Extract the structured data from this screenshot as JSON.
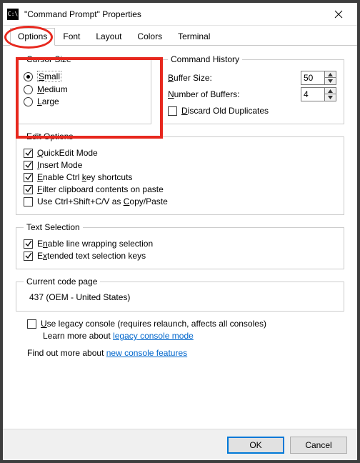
{
  "window": {
    "title": "\"Command Prompt\" Properties"
  },
  "tabs": {
    "options": "Options",
    "font": "Font",
    "layout": "Layout",
    "colors": "Colors",
    "terminal": "Terminal"
  },
  "cursor_size": {
    "legend": "Cursor Size",
    "small": "Small",
    "medium": "Medium",
    "large": "Large"
  },
  "command_history": {
    "legend": "Command History",
    "buffer_size_label": "Buffer Size:",
    "buffer_size_value": "50",
    "num_buffers_label": "Number of Buffers:",
    "num_buffers_value": "4",
    "discard_label": "Discard Old Duplicates"
  },
  "edit_options": {
    "legend": "Edit Options",
    "quickedit": "QuickEdit Mode",
    "insert": "Insert Mode",
    "ctrl_shortcuts": "Enable Ctrl key shortcuts",
    "filter_clip": "Filter clipboard contents on paste",
    "use_cs_cv": "Use Ctrl+Shift+C/V as Copy/Paste"
  },
  "text_selection": {
    "legend": "Text Selection",
    "line_wrap": "Enable line wrapping selection",
    "extended": "Extended text selection keys"
  },
  "codepage": {
    "legend": "Current code page",
    "value": "437   (OEM - United States)"
  },
  "legacy": {
    "checkbox_label": "Use legacy console (requires relaunch, affects all consoles)",
    "learn_more_prefix": "Learn more about ",
    "learn_more_link": "legacy console mode"
  },
  "find_out": {
    "prefix": "Find out more about ",
    "link": "new console features"
  },
  "footer": {
    "ok": "OK",
    "cancel": "Cancel"
  }
}
